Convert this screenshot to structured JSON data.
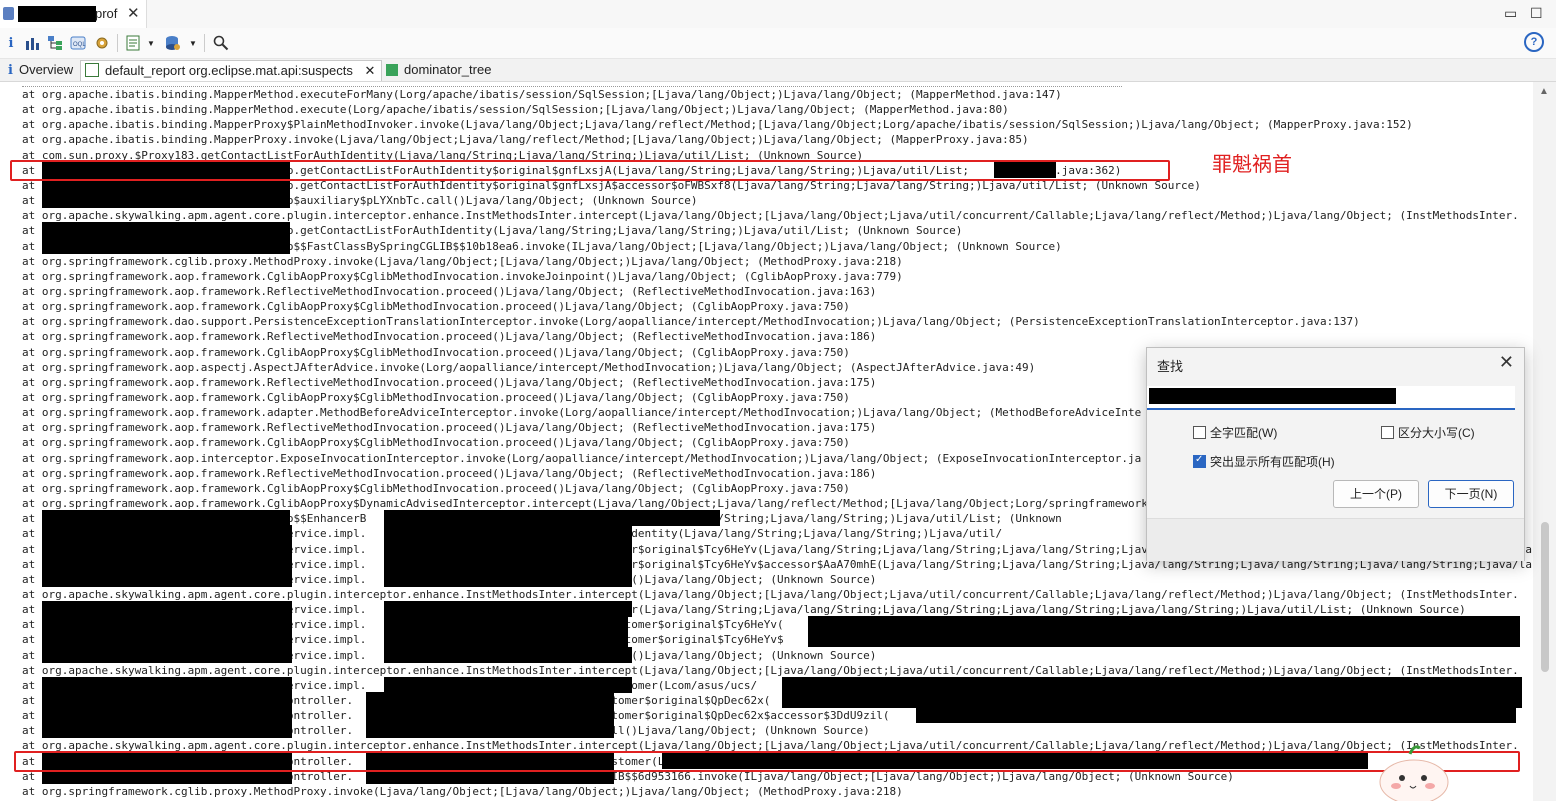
{
  "editor_tab": {
    "filename_suffix": "prof",
    "close": "✕"
  },
  "window_buttons": {
    "minimize": "▭",
    "maximize": "☐"
  },
  "toolbar": {
    "info_icon": "i",
    "help_icon": "?"
  },
  "view_tabs": [
    {
      "label": "Overview"
    },
    {
      "label": "default_report org.eclipse.mat.api:suspects",
      "close": "✕"
    },
    {
      "label": "dominator_tree"
    }
  ],
  "annotation": "罪魁祸首",
  "lines": [
    "at org.apache.ibatis.binding.MapperMethod.executeForMany(Lorg/apache/ibatis/session/SqlSession;[Ljava/lang/Object;)Ljava/lang/Object; (MapperMethod.java:147)",
    "at org.apache.ibatis.binding.MapperMethod.execute(Lorg/apache/ibatis/session/SqlSession;[Ljava/lang/Object;)Ljava/lang/Object; (MapperMethod.java:80)",
    "at org.apache.ibatis.binding.MapperProxy$PlainMethodInvoker.invoke(Ljava/lang/Object;Ljava/lang/reflect/Method;[Ljava/lang/Object;Lorg/apache/ibatis/session/SqlSession;)Ljava/lang/Object; (MapperProxy.java:152)",
    "at org.apache.ibatis.binding.MapperProxy.invoke(Ljava/lang/Object;Ljava/lang/reflect/Method;[Ljava/lang/Object;)Ljava/lang/Object; (MapperProxy.java:85)",
    "at com.sun.proxy.$Proxy183.getContactListForAuthIdentity(Ljava/lang/String;Ljava/lang/String;)Ljava/util/List; (Unknown Source)",
    "at                                    Dao.getContactListForAuthIdentity$original$gnfLxsjA(Ljava/lang/String;Ljava/lang/String;)Ljava/util/List;          Dao.java:362)",
    "at                                    Dao.getContactListForAuthIdentity$original$gnfLxsjA$accessor$oFWBSxf8(Ljava/lang/String;Ljava/lang/String;)Ljava/util/List; (Unknown Source)",
    "at                                    Dao$auxiliary$pLYXnbTc.call()Ljava/lang/Object; (Unknown Source)",
    "at org.apache.skywalking.apm.agent.core.plugin.interceptor.enhance.InstMethodsInter.intercept(Ljava/lang/Object;[Ljava/lang/Object;Ljava/util/concurrent/Callable;Ljava/lang/reflect/Method;)Ljava/lang/Object; (InstMethodsInter.",
    "at                                    Dao.getContactListForAuthIdentity(Ljava/lang/String;Ljava/lang/String;)Ljava/util/List; (Unknown Source)",
    "at                                    Dao$$FastClassBySpringCGLIB$$10b18ea6.invoke(ILjava/lang/Object;[Ljava/lang/Object;)Ljava/lang/Object; (Unknown Source)",
    "at org.springframework.cglib.proxy.MethodProxy.invoke(Ljava/lang/Object;[Ljava/lang/Object;)Ljava/lang/Object; (MethodProxy.java:218)",
    "at org.springframework.aop.framework.CglibAopProxy$CglibMethodInvocation.invokeJoinpoint()Ljava/lang/Object; (CglibAopProxy.java:779)",
    "at org.springframework.aop.framework.ReflectiveMethodInvocation.proceed()Ljava/lang/Object; (ReflectiveMethodInvocation.java:163)",
    "at org.springframework.aop.framework.CglibAopProxy$CglibMethodInvocation.proceed()Ljava/lang/Object; (CglibAopProxy.java:750)",
    "at org.springframework.dao.support.PersistenceExceptionTranslationInterceptor.invoke(Lorg/aopalliance/intercept/MethodInvocation;)Ljava/lang/Object; (PersistenceExceptionTranslationInterceptor.java:137)",
    "at org.springframework.aop.framework.ReflectiveMethodInvocation.proceed()Ljava/lang/Object; (ReflectiveMethodInvocation.java:186)",
    "at org.springframework.aop.framework.CglibAopProxy$CglibMethodInvocation.proceed()Ljava/lang/Object; (CglibAopProxy.java:750)",
    "at org.springframework.aop.aspectj.AspectJAfterAdvice.invoke(Lorg/aopalliance/intercept/MethodInvocation;)Ljava/lang/Object; (AspectJAfterAdvice.java:49)",
    "at org.springframework.aop.framework.ReflectiveMethodInvocation.proceed()Ljava/lang/Object; (ReflectiveMethodInvocation.java:175)",
    "at org.springframework.aop.framework.CglibAopProxy$CglibMethodInvocation.proceed()Ljava/lang/Object; (CglibAopProxy.java:750)",
    "at org.springframework.aop.framework.adapter.MethodBeforeAdviceInterceptor.invoke(Lorg/aopalliance/intercept/MethodInvocation;)Ljava/lang/Object; (MethodBeforeAdviceInte",
    "at org.springframework.aop.framework.ReflectiveMethodInvocation.proceed()Ljava/lang/Object; (ReflectiveMethodInvocation.java:175)",
    "at org.springframework.aop.framework.CglibAopProxy$CglibMethodInvocation.proceed()Ljava/lang/Object; (CglibAopProxy.java:750)",
    "at org.springframework.aop.interceptor.ExposeInvocationInterceptor.invoke(Lorg/aopalliance/intercept/MethodInvocation;)Ljava/lang/Object; (ExposeInvocationInterceptor.ja",
    "at org.springframework.aop.framework.ReflectiveMethodInvocation.proceed()Ljava/lang/Object; (ReflectiveMethodInvocation.java:186)",
    "at org.springframework.aop.framework.CglibAopProxy$CglibMethodInvocation.proceed()Ljava/lang/Object; (CglibAopProxy.java:750)",
    "at org.springframework.aop.framework.CglibAopProxy$DynamicAdvisedInterceptor.intercept(Ljava/lang/Object;Ljava/lang/reflect/Method;[Ljava/lang/Object;Lorg/springframework",
    "at                                    Dao$$EnhancerB                                         y(Ljava/lang/String;Ljava/lang/String;)Ljava/util/List; (Unknown",
    "at                                     service.impl.                                    uthIdentity(Ljava/lang/String;Ljava/lang/String;)Ljava/util/",
    "at                                     service.impl.                                    tomer$original$Tcy6HeYv(Ljava/lang/String;Ljava/lang/String;Ljava/lang/String;Ljava/lang/String;Ljava/lang/String;Ljava/lang/String;Ljava/lang/String;Ljava/lang/Strin",
    "at                                     service.impl.                                    tomer$original$Tcy6HeYv$accessor$AaA70mhE(Ljava/lang/String;Ljava/lang/String;Ljava/lang/String;Ljava/lang/String;Ljava/lang/String;Ljava/lang/String;Lj",
    "at                                     service.impl.                                    call()Ljava/lang/Object; (Unknown Source)",
    "at org.apache.skywalking.apm.agent.core.plugin.interceptor.enhance.InstMethodsInter.intercept(Ljava/lang/Object;[Ljava/lang/Object;Ljava/util/concurrent/Callable;Ljava/lang/reflect/Method;)Ljava/lang/Object; (InstMethodsInter.",
    "at                                     service.impl.                                    tomer(Ljava/lang/String;Ljava/lang/String;Ljava/lang/String;Ljava/lang/String;Ljava/lang/String;)Ljava/util/List; (Unknown Source)",
    "at                                     service.impl.                                    Customer$original$Tcy6HeYv(",
    "at                                     service.impl.                                    Customer$original$Tcy6HeYv$",
    "at                                     service.impl.                                    call()Ljava/lang/Object; (Unknown Source)",
    "at org.apache.skywalking.apm.agent.core.plugin.interceptor.enhance.InstMethodsInter.intercept(Ljava/lang/Object;[Ljava/lang/Object;Ljava/util/concurrent/Callable;Ljava/lang/reflect/Method;)Ljava/lang/Object; (InstMethodsInter.",
    "at                                     service.impl.                                    Customer(Lcom/asus/ucs/",
    "at                                     controller.                                     ustomer$original$QpDec62x(",
    "at                                     controller.                                     ustomer$original$QpDec62x$accessor$3DdU9zil(",
    "at                                     controller.                                     call()Ljava/lang/Object; (Unknown Source)",
    "at org.apache.skywalking.apm.agent.core.plugin.interceptor.enhance.InstMethodsInter.intercept(Ljava/lang/Object;[Ljava/lang/Object;Ljava/util/concurrent/Callable;Ljava/lang/reflect/Method;)Ljava/lang/Object; (InstMethodsInter.",
    "at                                     controller.                                     Customer(L",
    "at                                     controller.                                     GLIB$$6d953166.invoke(ILjava/lang/Object;[Ljava/lang/Object;)Ljava/lang/Object; (Unknown Source)",
    "at org.springframework.cglib.proxy.MethodProxy.invoke(Ljava/lang/Object;[Ljava/lang/Object;)Ljava/lang/Object; (MethodProxy.java:218)"
  ],
  "dialog": {
    "title": "查找",
    "close": "✕",
    "options": {
      "whole_word": "全字匹配(W)",
      "case_sensitive": "区分大小写(C)",
      "highlight_all": "突出显示所有匹配项(H)"
    },
    "prev_button": "上一个(P)",
    "next_button": "下一页(N)"
  },
  "colors": {
    "highlight_box": "#e02020",
    "accent": "#2a66c2"
  }
}
